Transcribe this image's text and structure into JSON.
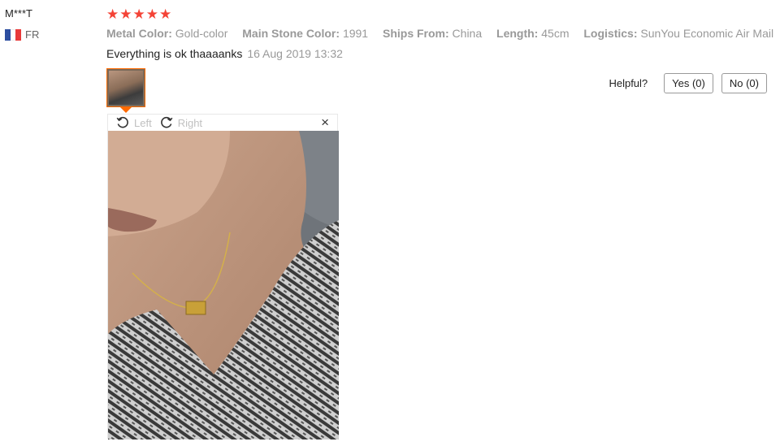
{
  "review": {
    "user": "M***T",
    "country_code": "FR",
    "stars": "★★★★★",
    "props": [
      {
        "label": "Metal Color:",
        "value": "Gold-color"
      },
      {
        "label": "Main Stone Color:",
        "value": "1991"
      },
      {
        "label": "Ships From:",
        "value": "China"
      },
      {
        "label": "Length:",
        "value": "45cm"
      },
      {
        "label": "Logistics:",
        "value": "SunYou Economic Air Mail"
      }
    ],
    "text": "Everything is ok thaaaanks",
    "date": "16 Aug 2019 13:32",
    "helpful_label": "Helpful?",
    "yes_label": "Yes (0)",
    "no_label": "No (0)"
  },
  "viewer": {
    "rotate_left_label": "Left",
    "rotate_right_label": "Right",
    "close_glyph": "×"
  },
  "colors": {
    "star": "#f44336",
    "thumb_border": "#ff6a00",
    "flag": [
      "#2d4ea0",
      "#ffffff",
      "#e83a3a"
    ]
  }
}
